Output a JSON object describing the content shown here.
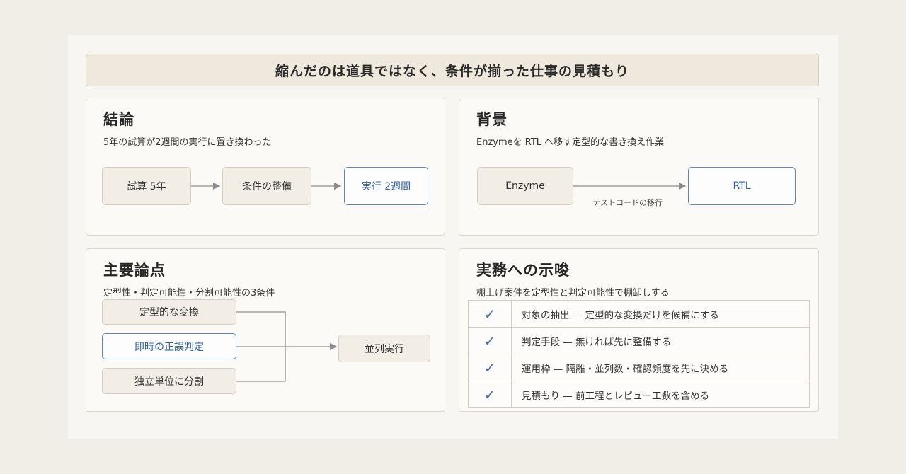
{
  "title": "縮んだのは道具ではなく、条件が揃った仕事の見積もり",
  "conclusion": {
    "heading": "結論",
    "subtitle": "5年の試算が2週間の実行に置き換わった",
    "steps": [
      "試算 5年",
      "条件の整備",
      "実行 2週間"
    ]
  },
  "background": {
    "heading": "背景",
    "subtitle": "Enzymeを RTL へ移す定型的な書き換え作業",
    "from": "Enzyme",
    "to": "RTL",
    "edge_label": "テストコードの移行"
  },
  "key_points": {
    "heading": "主要論点",
    "subtitle": "定型性・判定可能性・分割可能性の3条件",
    "inputs": [
      "定型的な変換",
      "即時の正誤判定",
      "独立単位に分割"
    ],
    "output": "並列実行"
  },
  "implications": {
    "heading": "実務への示唆",
    "subtitle": "棚上げ案件を定型性と判定可能性で棚卸しする",
    "check_mark": "✓",
    "items": [
      "対象の抽出 — 定型的な変換だけを候補にする",
      "判定手段 — 無ければ先に整備する",
      "運用枠 — 隔離・並列数・確認頻度を先に決める",
      "見積もり — 前工程とレビュー工数を含める"
    ]
  }
}
